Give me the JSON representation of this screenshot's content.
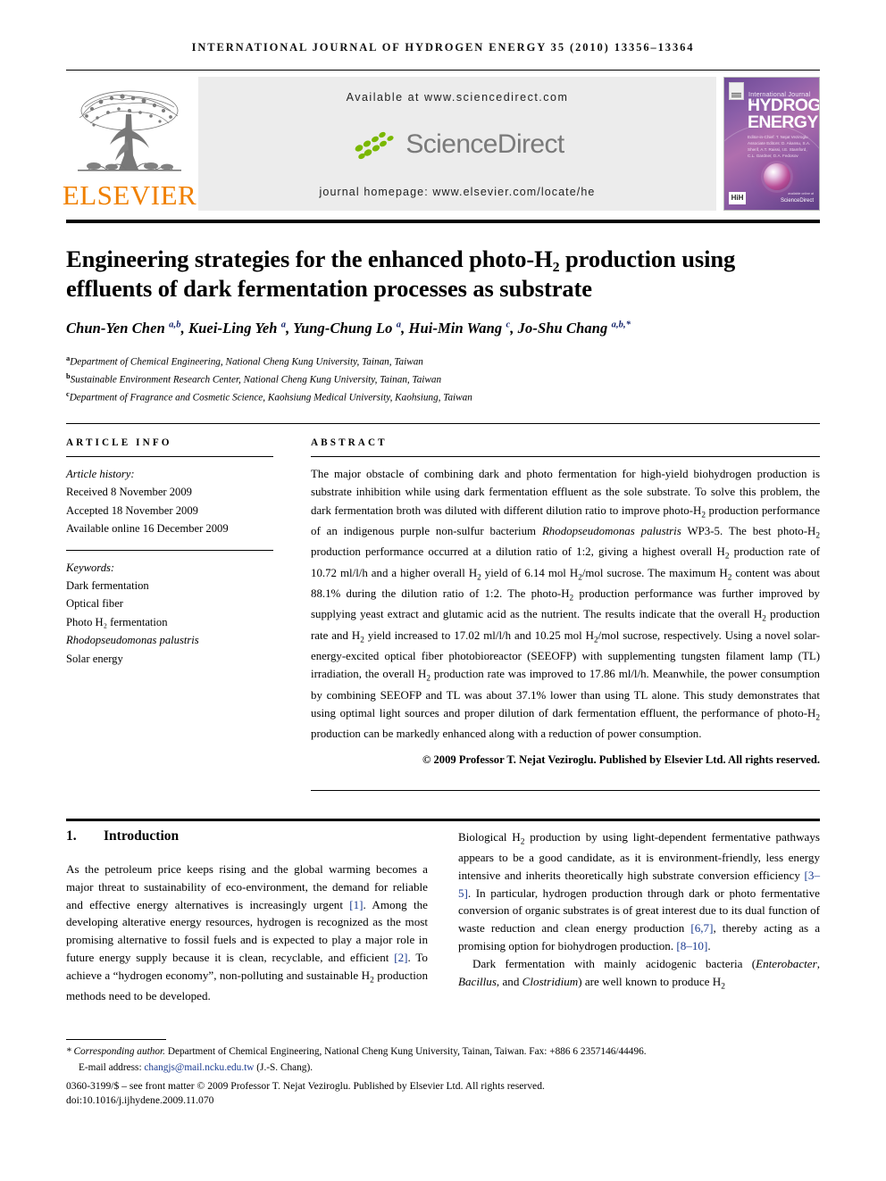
{
  "running_head": "international journal of hydrogen energy 35 (2010) 13356–13364",
  "masthead": {
    "publisher_name": "ELSEVIER",
    "available_at": "Available at www.sciencedirect.com",
    "sciencedirect_wordmark": "ScienceDirect",
    "journal_homepage": "journal homepage: www.elsevier.com/locate/he",
    "cover": {
      "line_small": "International Journal of",
      "line_big_1": "HYDROGEN",
      "line_big_2": "ENERGY",
      "editors": "Editor-in-Chief: T. Nejat Veziroglu   Associate Editors: D. Akansu, S.A. Sherif, A.T. Raissi, I.E. Stamford, C.L. Gardner, D.A. Fedosov",
      "hih_mark": "HiH",
      "sciencedirect_mark": "ScienceDirect",
      "sciencedirect_mark_top": "available online at"
    }
  },
  "article": {
    "title": "Engineering strategies for the enhanced photo-H₂ production using effluents of dark fermentation processes as substrate",
    "authors_html": "Chun-Yen Chen <sup>a,b</sup>, Kuei-Ling Yeh <sup>a</sup>, Yung-Chung Lo <sup>a</sup>, Hui-Min Wang <sup>c</sup>, Jo-Shu Chang <sup>a,b,*</sup>",
    "affiliations": [
      {
        "marker": "a",
        "text": "Department of Chemical Engineering, National Cheng Kung University, Tainan, Taiwan"
      },
      {
        "marker": "b",
        "text": "Sustainable Environment Research Center, National Cheng Kung University, Tainan, Taiwan"
      },
      {
        "marker": "c",
        "text": "Department of Fragrance and Cosmetic Science, Kaohsiung Medical University, Kaohsiung, Taiwan"
      }
    ]
  },
  "article_info": {
    "heading": "ARTICLE INFO",
    "history_label": "Article history:",
    "history": [
      "Received 8 November 2009",
      "Accepted 18 November 2009",
      "Available online 16 December 2009"
    ],
    "keywords_label": "Keywords:",
    "keywords": [
      "Dark fermentation",
      "Optical fiber",
      "Photo H₂ fermentation",
      "Rhodopseudomonas palustris",
      "Solar energy"
    ],
    "keyword_italic_index": 3
  },
  "abstract": {
    "heading": "ABSTRACT",
    "paragraph_html": "The major obstacle of combining dark and photo fermentation for high-yield biohydrogen production is substrate inhibition while using dark fermentation effluent as the sole substrate. To solve this problem, the dark fermentation broth was diluted with different dilution ratio to improve photo-H<sub>2</sub> production performance of an indigenous purple non-sulfur bacterium <span class=\"it\">Rhodopseudomonas palustris</span> WP3-5. The best photo-H<sub>2</sub> production performance occurred at a dilution ratio of 1:2, giving a highest overall H<sub>2</sub> production rate of 10.72 ml/l/h and a higher overall H<sub>2</sub> yield of 6.14 mol H<sub>2</sub>/mol sucrose. The maximum H<sub>2</sub> content was about 88.1% during the dilution ratio of 1:2. The photo-H<sub>2</sub> production performance was further improved by supplying yeast extract and glutamic acid as the nutrient. The results indicate that the overall H<sub>2</sub> production rate and H<sub>2</sub> yield increased to 17.02 ml/l/h and 10.25 mol H<sub>2</sub>/mol sucrose, respectively. Using a novel solar-energy-excited optical fiber photobioreactor (SEEOFP) with supplementing tungsten filament lamp (TL) irradiation, the overall H<sub>2</sub> production rate was improved to 17.86 ml/l/h. Meanwhile, the power consumption by combining SEEOFP and TL was about 37.1% lower than using TL alone. This study demonstrates that using optimal light sources and proper dilution of dark fermentation effluent, the performance of photo-H<sub>2</sub> production can be markedly enhanced along with a reduction of power consumption.",
    "copyright": "© 2009 Professor T. Nejat Veziroglu. Published by Elsevier Ltd. All rights reserved."
  },
  "body": {
    "section_number": "1.",
    "section_title": "Introduction",
    "left_paragraph_html": "As the petroleum price keeps rising and the global warming becomes a major threat to sustainability of eco-environment, the demand for reliable and effective energy alternatives is increasingly urgent <span class=\"ref\">[1]</span>. Among the developing alterative energy resources, hydrogen is recognized as the most promising alternative to fossil fuels and is expected to play a major role in future energy supply because it is clean, recyclable, and efficient <span class=\"ref\">[2]</span>. To achieve a &ldquo;hydrogen economy&rdquo;, non-polluting and sustainable H<sub>2</sub> production methods need to be developed.",
    "right_paragraph_1_html": "Biological H<sub>2</sub> production by using light-dependent fermentative pathways appears to be a good candidate, as it is environment-friendly, less energy intensive and inherits theoretically high substrate conversion efficiency <span class=\"ref\">[3&ndash;5]</span>. In particular, hydrogen production through dark or photo fermentative conversion of organic substrates is of great interest due to its dual function of waste reduction and clean energy production <span class=\"ref\">[6,7]</span>, thereby acting as a promising option for biohydrogen production. <span class=\"ref\">[8&ndash;10]</span>.",
    "right_paragraph_2_html": "Dark fermentation with mainly acidogenic bacteria (<span class=\"it\">Enterobacter</span>, <span class=\"it\">Bacillus</span>, and <span class=\"it\">Clostridium</span>) are well known to produce H<sub>2</sub>"
  },
  "footnotes": {
    "corresponding_html": "<span class=\"it\">* Corresponding author.</span> Department of Chemical Engineering, National Cheng Kung University, Tainan, Taiwan. Fax: +886 6 2357146/44496.",
    "email_label": "E-mail address:",
    "email_address": "changjs@mail.ncku.edu.tw",
    "email_suffix": "(J.-S. Chang).",
    "issn_line": "0360-3199/$ – see front matter © 2009 Professor T. Nejat Veziroglu. Published by Elsevier Ltd. All rights reserved.",
    "doi_line": "doi:10.1016/j.ijhydene.2009.11.070"
  },
  "colors": {
    "elsevier_orange": "#F08000",
    "reference_blue": "#1a3a8f",
    "sciencedirect_green": "#7AB800",
    "sciencedirect_gray": "#7a7a7a",
    "panel_gray": "#ececec"
  }
}
